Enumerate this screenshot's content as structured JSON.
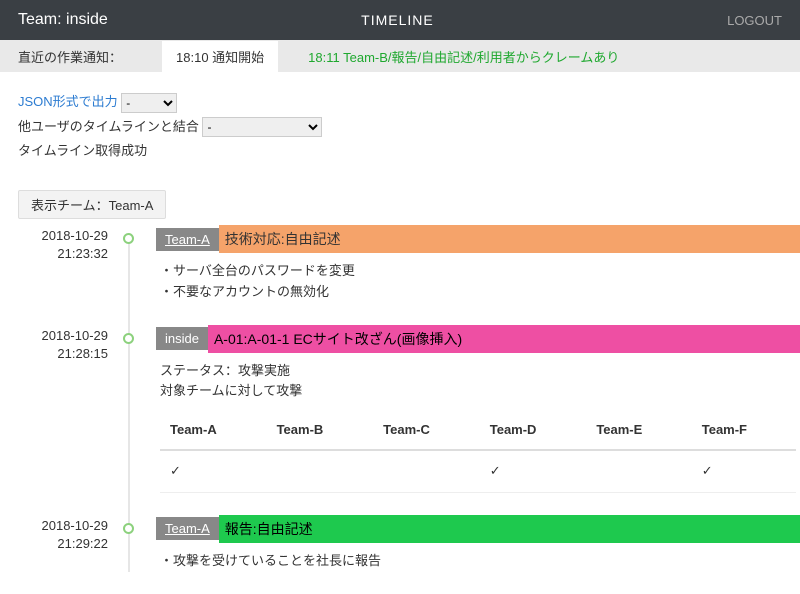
{
  "topbar": {
    "team_label": "Team: inside",
    "title": "TIMELINE",
    "logout": "LOGOUT"
  },
  "notice": {
    "label": "直近の作業通知：",
    "item1": "18:10 通知開始",
    "item2": "18:11 Team-B/報告/自由記述/利用者からクレームあり"
  },
  "controls": {
    "json_export": "JSON形式で出力",
    "merge_label": "他ユーザのタイムラインと結合",
    "sel1_value": "-",
    "sel2_value": "-",
    "status": "タイムライン取得成功"
  },
  "display_team": "表示チーム：Team-A",
  "entries": [
    {
      "date": "2018-10-29",
      "time": "21:23:32",
      "tag": "Team-A",
      "tag_type": "team",
      "bar_color": "orange",
      "title": "技術対応:自由記述",
      "detail_lines": [
        "・サーバ全台のパスワードを変更",
        "・不要なアカウントの無効化"
      ]
    },
    {
      "date": "2018-10-29",
      "time": "21:28:15",
      "tag": "inside",
      "tag_type": "inside",
      "bar_color": "pink",
      "title": "A-01:A-01-1 ECサイト改ざん(画像挿入)",
      "detail_lines": [
        "ステータス：攻撃実施",
        "対象チームに対して攻撃"
      ],
      "targets": {
        "headers": [
          "Team-A",
          "Team-B",
          "Team-C",
          "Team-D",
          "Team-E",
          "Team-F"
        ],
        "row": [
          "✓",
          "",
          "",
          "✓",
          "",
          "✓"
        ]
      }
    },
    {
      "date": "2018-10-29",
      "time": "21:29:22",
      "tag": "Team-A",
      "tag_type": "team",
      "bar_color": "green",
      "title": "報告:自由記述",
      "detail_lines": [
        "・攻撃を受けていることを社長に報告"
      ]
    }
  ]
}
